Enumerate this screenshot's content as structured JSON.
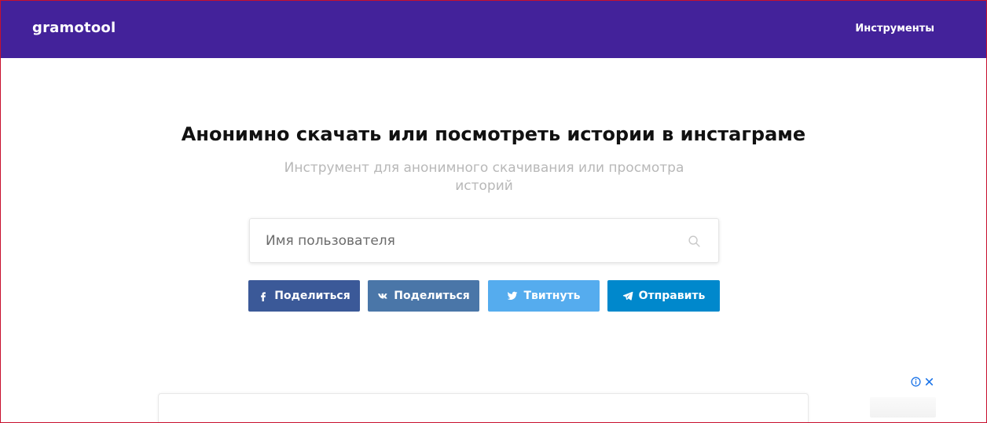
{
  "header": {
    "logo": "gramotool",
    "nav_link": "Инструменты"
  },
  "hero": {
    "title": "Анонимно скачать или посмотреть истории в инстаграме",
    "subtitle": "Инструмент для анонимного скачивания или просмотра историй"
  },
  "search": {
    "placeholder": "Имя пользователя",
    "value": "",
    "icon": "search-icon"
  },
  "share": {
    "buttons": [
      {
        "label": "Поделиться",
        "icon": "facebook-icon",
        "color": "#3b5998"
      },
      {
        "label": "Поделиться",
        "icon": "vk-icon",
        "color": "#4a76a8"
      },
      {
        "label": "Твитнуть",
        "icon": "twitter-icon",
        "color": "#55acee"
      },
      {
        "label": "Отправить",
        "icon": "telegram-icon",
        "color": "#0088cc"
      }
    ]
  },
  "ad": {
    "info_icon": "ad-info-icon",
    "close_icon": "ad-close-icon"
  },
  "colors": {
    "header_bg": "#43229a",
    "accent_blue": "#1a73e8",
    "frame_border": "#c8102e"
  }
}
